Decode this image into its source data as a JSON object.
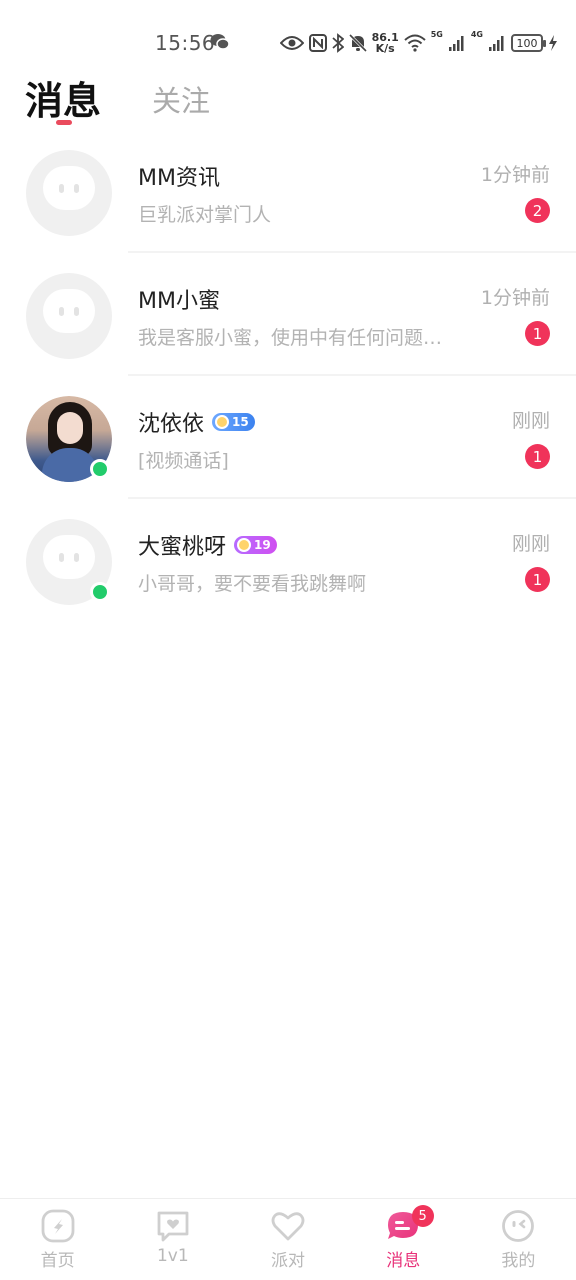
{
  "status_bar": {
    "time": "15:56",
    "net_speed_value": "86.1",
    "net_speed_unit": "K/s",
    "signal_1_label": "5G",
    "signal_2_label": "4G",
    "battery": "100"
  },
  "header": {
    "tab_active": "消息",
    "tab_inactive": "关注"
  },
  "conversations": [
    {
      "name": "MM资讯",
      "time": "1分钟前",
      "preview": "巨乳派对掌门人",
      "unread": "2"
    },
    {
      "name": "MM小蜜",
      "time": "1分钟前",
      "preview": "我是客服小蜜，使用中有任何问题随时联系我哦",
      "unread": "1"
    },
    {
      "name": "沈依依",
      "level": "15",
      "time": "刚刚",
      "preview": "[视频通话]",
      "unread": "1",
      "online": true
    },
    {
      "name": "大蜜桃呀",
      "level": "19",
      "time": "刚刚",
      "preview": "小哥哥，要不要看我跳舞啊",
      "unread": "1",
      "online": true
    }
  ],
  "bottom_nav": {
    "items": [
      {
        "label": "首页",
        "icon": "home-icon"
      },
      {
        "label": "1v1",
        "icon": "chat-heart-icon"
      },
      {
        "label": "派对",
        "icon": "heart-icon"
      },
      {
        "label": "消息",
        "icon": "message-icon",
        "badge": "5",
        "active": true
      },
      {
        "label": "我的",
        "icon": "profile-face-icon"
      }
    ]
  },
  "colors": {
    "accent": "#e8337a",
    "badge": "#f0335a",
    "online": "#22cc6b"
  }
}
